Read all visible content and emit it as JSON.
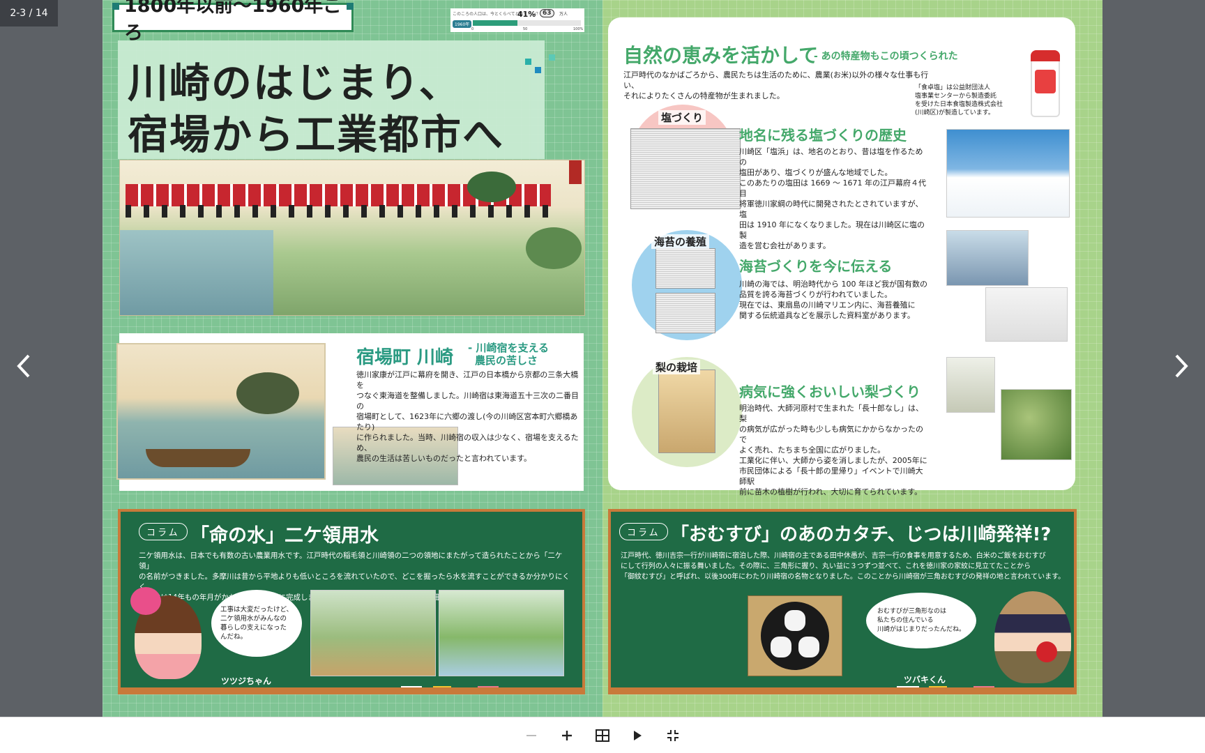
{
  "viewer": {
    "page_counter": "2-3 / 14"
  },
  "left": {
    "era_title": "1800年以前～1960年ごろ",
    "population": {
      "question": "このころの人口は、今とくらべてどのくらい？",
      "percent": "41%",
      "badge": "63",
      "unit": "万人",
      "year": "1960年",
      "fill_fraction": 0.41,
      "axis": [
        "0",
        "50",
        "100%"
      ]
    },
    "main_title_1": "川崎のはじまり、",
    "main_title_2": "宿場から工業都市へ",
    "shuku": {
      "title": "宿場町 川崎",
      "subtitle_1": "- 川崎宿を支える",
      "subtitle_2": "農民の苦しさ",
      "body": [
        "徳川家康が江戸に幕府を開き、江戸の日本橋から京都の三条大橋を",
        "つなぐ東海道を整備しました。川崎宿は東海道五十三次の二番目の",
        "宿場町として、1623年に六郷の渡し(今の川崎区宮本町六郷橋あたり)",
        "に作られました。当時、川崎宿の収入は少なく、宿場を支えるため、",
        "農民の生活は苦しいものだったと言われています。"
      ]
    },
    "column": {
      "tag": "コラム",
      "title": "「命の水」二ケ領用水",
      "body": [
        "二ケ領用水は、日本でも有数の古い農業用水です。江戸時代の稲毛領と川崎領の二つの領地にまたがって造られたことから「二ケ領」",
        "の名前がつきました。多摩川は昔から平地よりも低いところを流れていたので、どこを掘ったら水を流すことができるか分かりにくく、",
        "工事には14年もの年月がかかり、1611 年に完成しました。二ケ領用水の完成により、田畑が潤い、領地の農業の基盤になりました。"
      ],
      "bubble": [
        "工事は大変だったけど、",
        "二ケ領用水がみんなの",
        "暮らしの支えになった",
        "んだね。"
      ],
      "character": "ツツジちゃん"
    }
  },
  "right": {
    "heading": "自然の恵みを活かして",
    "heading_sub": "- あの特産物もこの頃つくられた",
    "intro": [
      "江戸時代のなかばごろから、農民たちは生活のために、農業(お米)以外の様々な仕事も行い、",
      "それによりたくさんの特産物が生まれました。"
    ],
    "salt_note": [
      "「食卓塩」は公益財団法人",
      "塩事業センターから製造委託",
      "を受けた日本食塩製造株式会社",
      "(川崎区)が製造しています。"
    ],
    "sections": [
      {
        "circle": "塩づくり",
        "title": "地名に残る塩づくりの歴史",
        "body": [
          "川崎区「塩浜」は、地名のとおり、昔は塩を作るための",
          "塩田があり、塩づくりが盛んな地域でした。",
          "このあたりの塩田は 1669 ～ 1671 年の江戸幕府４代目",
          "将軍徳川家綱の時代に開発されたとされていますが、塩",
          "田は 1910 年になくなりました。現在は川崎区に塩の製",
          "造を営む会社があります。"
        ]
      },
      {
        "circle": "海苔の養殖",
        "title": "海苔づくりを今に伝える",
        "body": [
          "川崎の海では、明治時代から 100 年ほど我が国有数の",
          "品質を誇る海苔づくりが行われていました。",
          "現在では、東扇島の川崎マリエン内に、海苔養殖に",
          "関する伝統道具などを展示した資料室があります。"
        ]
      },
      {
        "circle": "梨の栽培",
        "title": "病気に強くおいしい梨づくり",
        "body": [
          "明治時代、大師河原村で生まれた「長十郎なし」は、梨",
          "の病気が広がった時も少しも病気にかからなかったので",
          "よく売れ、たちまち全国に広がりました。",
          "工業化に伴い、大師から姿を消しましたが、2005年に",
          "市民団体による「長十郎の里帰り」イベントで川崎大師駅",
          "前に苗木の植樹が行われ、大切に育てられています。"
        ]
      }
    ],
    "column": {
      "tag": "コラム",
      "title": "「おむすび」のあのカタチ、じつは川崎発祥!?",
      "body": [
        "江戸時代、徳川吉宗一行が川崎宿に宿泊した際、川崎宿の主である田中休愚が、吉宗一行の食事を用意するため、白米のご飯をおむすび",
        "にして行列の人々に振る舞いました。その際に、三角形に握り、丸い益に３つずつ並べて、これを徳川家の家紋に見立てたことから",
        "「御紋むすび」と呼ばれ、以後300年にわたり川崎宿の名物となりました。このことから川崎宿が三角おむすびの発祥の地と言われています。"
      ],
      "bubble": [
        "おむすびが三角形なのは",
        "私たちの住んでいる",
        "川崎がはじまりだったんだね。"
      ],
      "character": "ツバキくん"
    }
  },
  "toolbar": {
    "zoom_out": "zoom-out",
    "zoom_in": "zoom-in",
    "grid": "grid",
    "play": "play",
    "fit": "fit-screen"
  }
}
